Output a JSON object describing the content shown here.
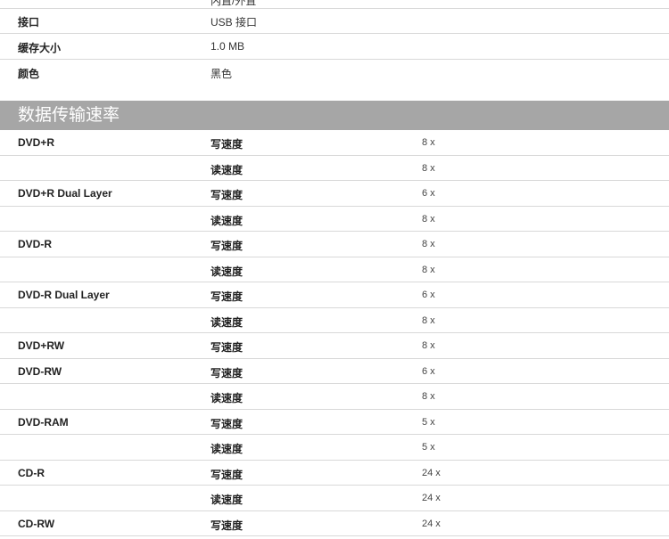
{
  "cutoff_row": {
    "value": "内置/外置"
  },
  "specs": [
    {
      "key": "接口",
      "value": "USB 接口"
    },
    {
      "key": "缓存大小",
      "value": "1.0 MB"
    },
    {
      "key": "颜色",
      "value": "黑色"
    }
  ],
  "section": {
    "title": "数据传输速率"
  },
  "speed_rows": [
    {
      "media": "DVD+R",
      "op": "写速度",
      "speed": "8 x"
    },
    {
      "media": "",
      "op": "读速度",
      "speed": "8 x"
    },
    {
      "media": "DVD+R Dual Layer",
      "op": "写速度",
      "speed": "6 x"
    },
    {
      "media": "",
      "op": "读速度",
      "speed": "8 x"
    },
    {
      "media": "DVD-R",
      "op": "写速度",
      "speed": "8 x"
    },
    {
      "media": "",
      "op": "读速度",
      "speed": "8 x"
    },
    {
      "media": "DVD-R Dual Layer",
      "op": "写速度",
      "speed": "6 x"
    },
    {
      "media": "",
      "op": "读速度",
      "speed": "8 x"
    },
    {
      "media": "DVD+RW",
      "op": "写速度",
      "speed": "8 x"
    },
    {
      "media": "DVD-RW",
      "op": "写速度",
      "speed": "6 x"
    },
    {
      "media": "",
      "op": "读速度",
      "speed": "8 x"
    },
    {
      "media": "DVD-RAM",
      "op": "写速度",
      "speed": "5 x"
    },
    {
      "media": "",
      "op": "读速度",
      "speed": "5 x"
    },
    {
      "media": "CD-R",
      "op": "写速度",
      "speed": "24 x"
    },
    {
      "media": "",
      "op": "读速度",
      "speed": "24 x"
    },
    {
      "media": "CD-RW",
      "op": "写速度",
      "speed": "24 x"
    }
  ],
  "colors": {
    "section_bg": "#a6a6a6",
    "divider": "#d8d8d8"
  }
}
